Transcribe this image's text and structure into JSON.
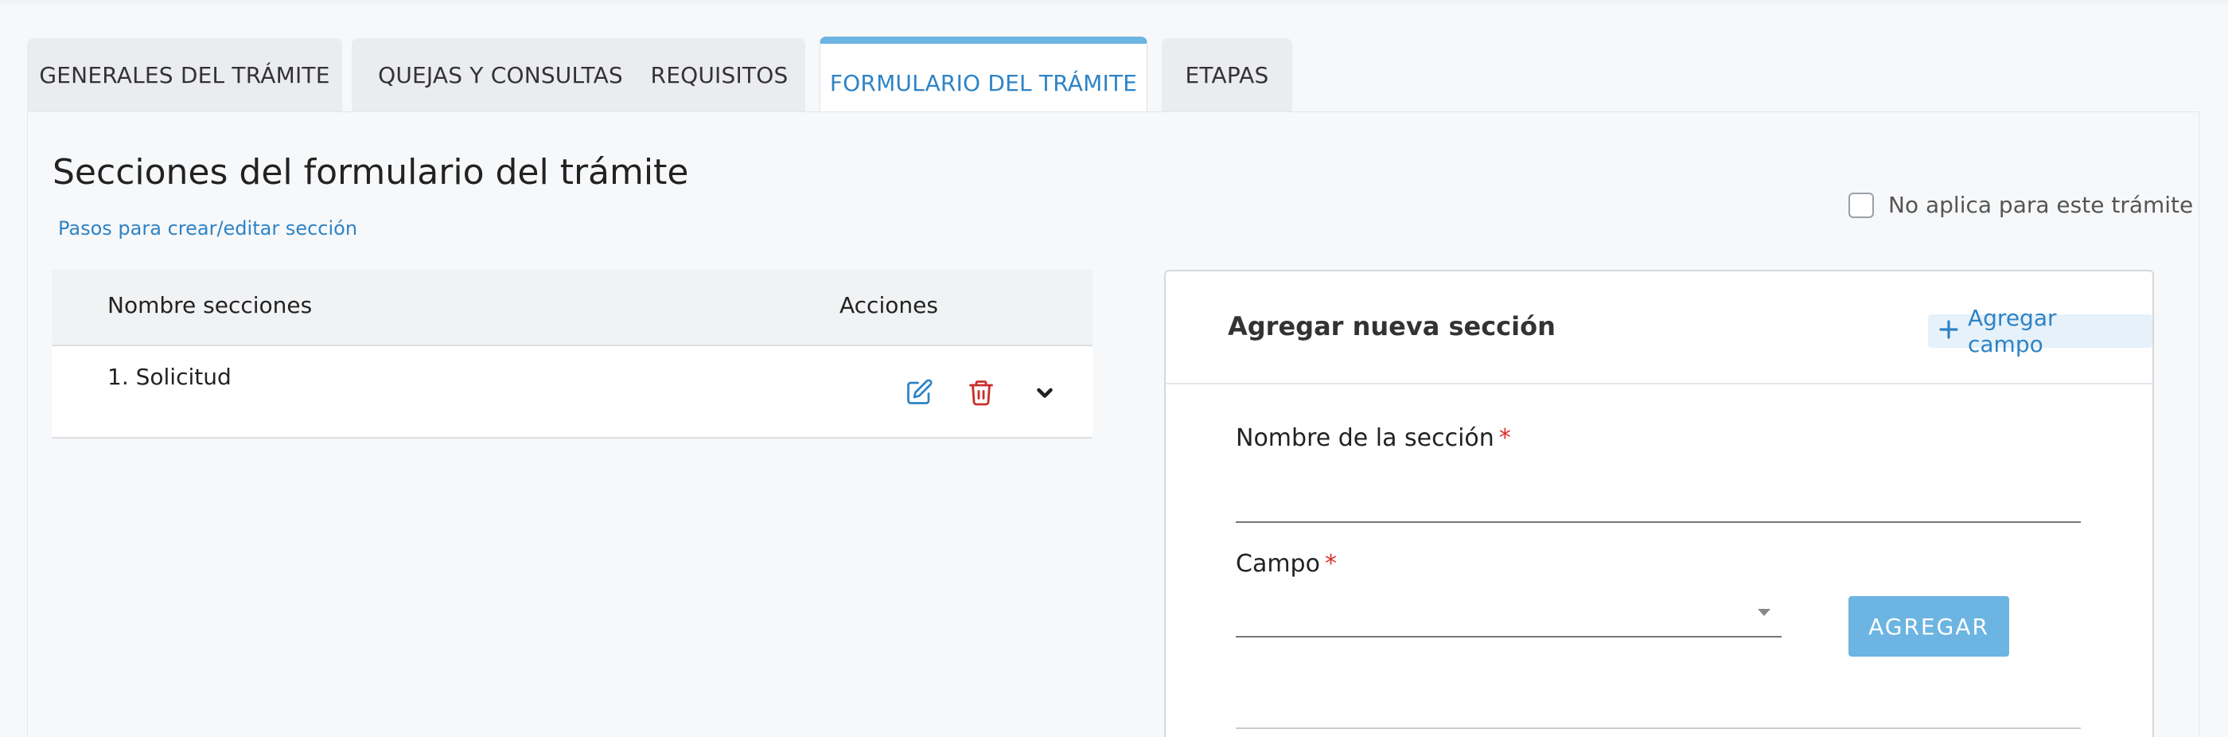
{
  "tabs": [
    {
      "label": "GENERALES DEL TRÁMITE",
      "active": false
    },
    {
      "label": "QUEJAS Y CONSULTAS",
      "active": false
    },
    {
      "label": "REQUISITOS",
      "active": false
    },
    {
      "label": "FORMULARIO DEL TRÁMITE",
      "active": true
    },
    {
      "label": "ETAPAS",
      "active": false
    }
  ],
  "page": {
    "title": "Secciones del formulario del trámite",
    "steps_link": "Pasos para crear/editar sección",
    "not_applicable_label": "No aplica para este trámite",
    "not_applicable_checked": false
  },
  "table": {
    "headers": {
      "name": "Nombre secciones",
      "actions": "Acciones"
    },
    "rows": [
      {
        "name": "1. Solicitud",
        "actions": [
          "edit-icon",
          "trash-icon",
          "chevron-down-icon"
        ]
      }
    ]
  },
  "card": {
    "title": "Agregar nueva sección",
    "add_field_label": "Agregar campo",
    "section_name_label": "Nombre de la sección",
    "section_name_value": "",
    "field_label": "Campo",
    "field_value": "",
    "required_mark": "*",
    "add_button_label": "AGREGAR"
  },
  "colors": {
    "accent": "#2d83c6",
    "active_tab_border": "#6cb4e2",
    "button_bg": "#6cb4e2",
    "delete_red": "#c8302c",
    "required_red": "#d9302c"
  }
}
